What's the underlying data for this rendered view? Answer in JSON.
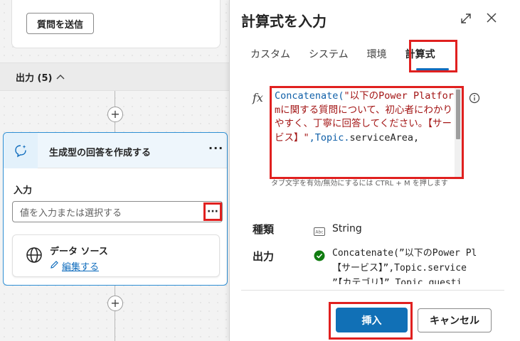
{
  "canvas": {
    "send_button_label": "質問を送信",
    "output_section_label": "出力 (5)",
    "generative_node": {
      "title": "生成型の回答を作成する",
      "more_label": "···",
      "input_label": "入力",
      "input_placeholder": "値を入力または選択する",
      "input_more_label": "···",
      "datasource_title": "データ ソース",
      "datasource_edit_label": "編集する"
    }
  },
  "panel": {
    "title": "計算式を入力",
    "tabs": [
      {
        "label": "カスタム"
      },
      {
        "label": "システム"
      },
      {
        "label": "環境"
      },
      {
        "label": "計算式",
        "active": true
      }
    ],
    "fx_label": "fx",
    "formula": {
      "fn": "Concatenate(",
      "str1": "\"以下のPower Platformに関する質問について、初心者にわかりやすく、丁寧に回答してください。【サービス】\"",
      "sep": ",Topic.",
      "tail": "serviceArea,"
    },
    "hint_text": "タブ文字を有効/無効にするには CTRL + M を押します",
    "kind_label": "種類",
    "kind_value": "String",
    "output_label": "出力",
    "output_lines": [
      "Concatenate(”以下のPower Pl",
      "【サービス】”,Topic.service",
      "”【カテゴリ】”,Topic.questi"
    ],
    "insert_label": "挿入",
    "cancel_label": "キャンセル"
  },
  "colors": {
    "accent": "#1170b6",
    "highlight": "#e0201f",
    "success": "#107c10",
    "selection_border": "#2f8fd4"
  }
}
